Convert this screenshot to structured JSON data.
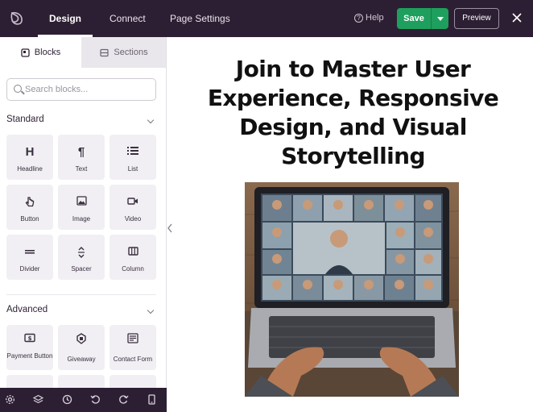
{
  "topbar": {
    "tabs": [
      {
        "label": "Design",
        "active": true
      },
      {
        "label": "Connect",
        "active": false
      },
      {
        "label": "Page Settings",
        "active": false
      }
    ],
    "help_label": "Help",
    "save_label": "Save",
    "preview_label": "Preview",
    "accent_color": "#1e9f5d",
    "bar_color": "#2d1f33"
  },
  "sidebar": {
    "tabs": [
      {
        "label": "Blocks",
        "icon": "blocks-icon",
        "active": true
      },
      {
        "label": "Sections",
        "icon": "sections-icon",
        "active": false
      }
    ],
    "search_placeholder": "Search blocks...",
    "groups": [
      {
        "title": "Standard",
        "blocks": [
          {
            "label": "Headline",
            "icon": "heading-icon"
          },
          {
            "label": "Text",
            "icon": "paragraph-icon"
          },
          {
            "label": "List",
            "icon": "list-icon"
          },
          {
            "label": "Button",
            "icon": "pointer-icon"
          },
          {
            "label": "Image",
            "icon": "image-icon"
          },
          {
            "label": "Video",
            "icon": "video-icon"
          },
          {
            "label": "Divider",
            "icon": "divider-icon"
          },
          {
            "label": "Spacer",
            "icon": "spacer-icon"
          },
          {
            "label": "Column",
            "icon": "column-icon"
          }
        ]
      },
      {
        "title": "Advanced",
        "blocks": [
          {
            "label": "Payment Button",
            "icon": "payment-icon"
          },
          {
            "label": "Giveaway",
            "icon": "giveaway-icon"
          },
          {
            "label": "Contact Form",
            "icon": "contact-form-icon"
          }
        ]
      }
    ],
    "bottom_tools": [
      "settings-icon",
      "layers-icon",
      "history-icon",
      "undo-icon",
      "redo-icon",
      "mobile-preview-icon"
    ]
  },
  "canvas": {
    "headline": "Join to Master User Experience, Responsive Design, and Visual Storytelling",
    "image_desc_icon": "laptop-video-call-image"
  }
}
